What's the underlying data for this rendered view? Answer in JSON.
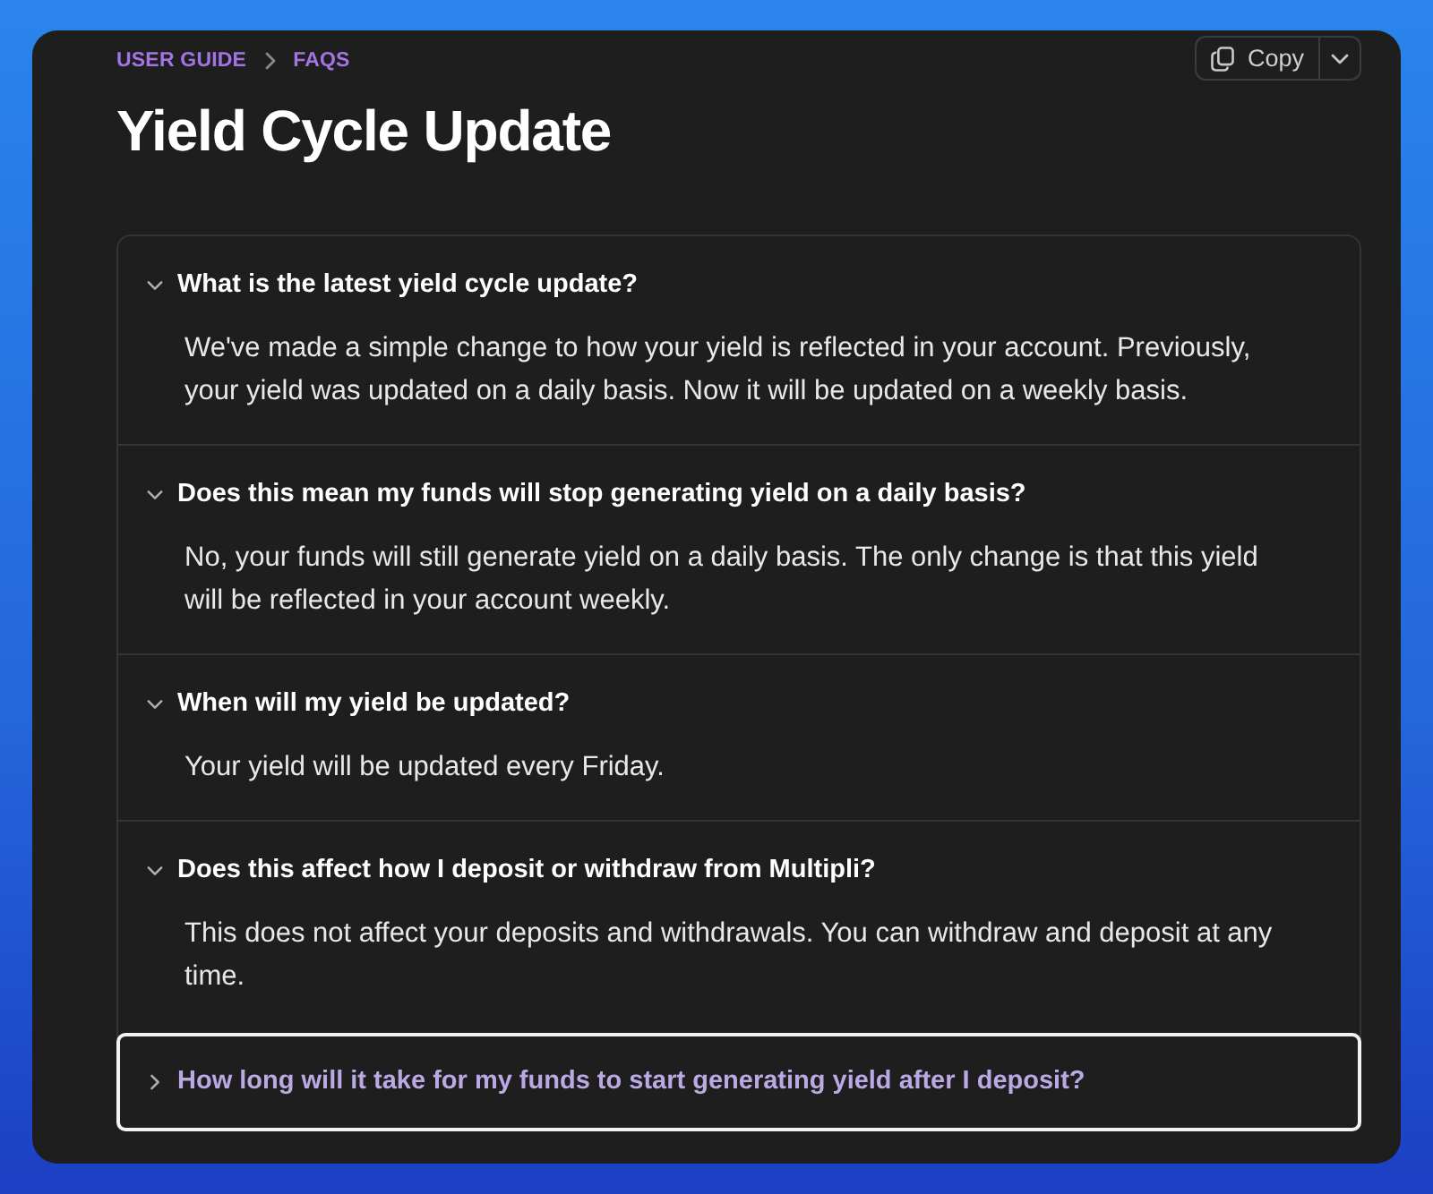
{
  "breadcrumb": [
    "USER GUIDE",
    "FAQS"
  ],
  "copy_button": {
    "label": "Copy"
  },
  "title": "Yield Cycle Update",
  "faqs": [
    {
      "question": "What is the latest yield cycle update?",
      "answer": "We've made a simple change to how your yield is reflected in your account. Previously, your yield was updated on a daily basis. Now it will be updated on a weekly basis.",
      "expanded": true,
      "focused": false
    },
    {
      "question": "Does this mean my funds will stop generating yield on a daily basis?",
      "answer": "No, your funds will still generate yield on a daily basis. The only change is that this yield will be reflected in your account weekly.",
      "expanded": true,
      "focused": false
    },
    {
      "question": "When will my yield be updated?",
      "answer": "Your yield will be updated every Friday.",
      "expanded": true,
      "focused": false
    },
    {
      "question": "Does this affect how I deposit or withdraw from Multipli?",
      "answer": "This does not affect your deposits and withdrawals. You can withdraw and deposit at any time.",
      "expanded": true,
      "focused": false
    },
    {
      "question": "How long will it take for my funds to start generating yield after I deposit?",
      "expanded": false,
      "focused": true
    }
  ]
}
